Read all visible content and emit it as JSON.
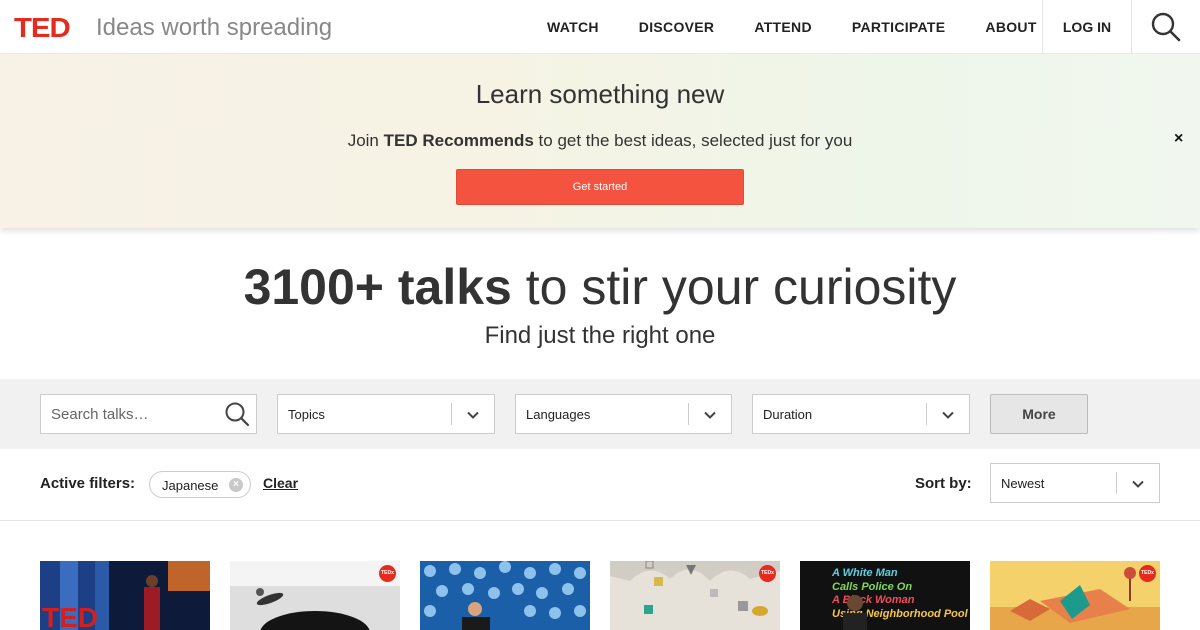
{
  "header": {
    "logo": "TED",
    "tagline": "Ideas worth spreading",
    "nav": [
      "WATCH",
      "DISCOVER",
      "ATTEND",
      "PARTICIPATE",
      "ABOUT"
    ],
    "login": "LOG IN",
    "search_icon": "search-icon",
    "brand_color": "#e62b1e"
  },
  "banner": {
    "title": "Learn something new",
    "sub_prefix": "Join ",
    "sub_bold": "TED Recommends",
    "sub_suffix": " to get the best ideas, selected just for you",
    "cta": "Get started",
    "close": "×",
    "cta_color": "#f4533f"
  },
  "hero": {
    "title_bold": "3100+ talks",
    "title_rest": " to stir your curiosity",
    "subtitle": "Find just the right one"
  },
  "filters": {
    "search_placeholder": "Search talks…",
    "topics": "Topics",
    "languages": "Languages",
    "duration": "Duration",
    "more": "More"
  },
  "active": {
    "label": "Active filters:",
    "chip": "Japanese",
    "chip_remove": "×",
    "clear": "Clear",
    "sort_label": "Sort by:",
    "sort_value": "Newest"
  },
  "thumbnails": [
    {
      "badge": ""
    },
    {
      "badge": "TEDx"
    },
    {
      "badge": ""
    },
    {
      "badge": "TEDx"
    },
    {
      "badge": "",
      "text_lines": [
        "A White Man",
        "Calls Police On",
        "A Black Woman",
        "Using Neighborhood Pool"
      ]
    },
    {
      "badge": "TEDx"
    }
  ]
}
